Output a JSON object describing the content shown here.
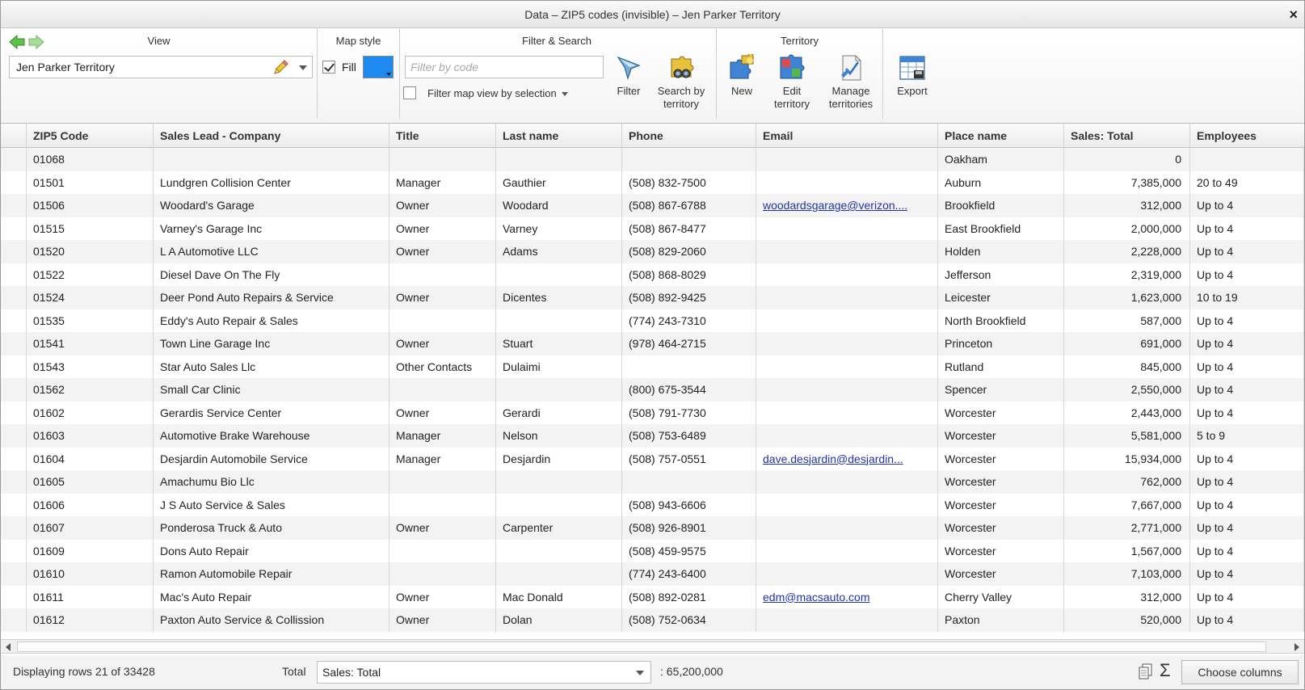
{
  "window": {
    "title": "Data – ZIP5 codes (invisible) – Jen Parker Territory",
    "close_glyph": "×"
  },
  "ribbon": {
    "view": {
      "title": "View",
      "selected": "Jen Parker Territory"
    },
    "map_style": {
      "title": "Map style",
      "fill_label": "Fill",
      "fill_checked": true,
      "fill_color": "#1e8af0"
    },
    "filter_search": {
      "title": "Filter & Search",
      "placeholder": "Filter by code",
      "value": "",
      "selection_label": "Filter map view by selection",
      "filter_label": "Filter",
      "search_label_1": "Search by",
      "search_label_2": "territory"
    },
    "territory": {
      "title": "Territory",
      "new_label": "New",
      "edit_label_1": "Edit",
      "edit_label_2": "territory",
      "manage_label_1": "Manage",
      "manage_label_2": "territories"
    },
    "export_label": "Export"
  },
  "grid": {
    "columns": {
      "zip": "ZIP5 Code",
      "company": "Sales Lead - Company",
      "title": "Title",
      "last": "Last name",
      "phone": "Phone",
      "email": "Email",
      "place": "Place name",
      "sales": "Sales: Total",
      "employees": "Employees"
    },
    "rows": [
      {
        "zip": "01068",
        "company": "",
        "title": "",
        "last": "",
        "phone": "",
        "email": "",
        "place": "Oakham",
        "sales": "0",
        "employees": ""
      },
      {
        "zip": "01501",
        "company": "Lundgren Collision Center",
        "title": "Manager",
        "last": "Gauthier",
        "phone": "(508) 832-7500",
        "email": "",
        "place": "Auburn",
        "sales": "7,385,000",
        "employees": "20 to 49"
      },
      {
        "zip": "01506",
        "company": "Woodard's Garage",
        "title": "Owner",
        "last": "Woodard",
        "phone": "(508) 867-6788",
        "email": "woodardsgarage@verizon....",
        "place": "Brookfield",
        "sales": "312,000",
        "employees": "Up to 4"
      },
      {
        "zip": "01515",
        "company": "Varney's Garage Inc",
        "title": "Owner",
        "last": "Varney",
        "phone": "(508) 867-8477",
        "email": "",
        "place": "East Brookfield",
        "sales": "2,000,000",
        "employees": "Up to 4"
      },
      {
        "zip": "01520",
        "company": "L A Automotive LLC",
        "title": "Owner",
        "last": "Adams",
        "phone": "(508) 829-2060",
        "email": "",
        "place": "Holden",
        "sales": "2,228,000",
        "employees": "Up to 4"
      },
      {
        "zip": "01522",
        "company": "Diesel Dave On The Fly",
        "title": "",
        "last": "",
        "phone": "(508) 868-8029",
        "email": "",
        "place": "Jefferson",
        "sales": "2,319,000",
        "employees": "Up to 4"
      },
      {
        "zip": "01524",
        "company": "Deer Pond Auto Repairs & Service",
        "title": "Owner",
        "last": "Dicentes",
        "phone": "(508) 892-9425",
        "email": "",
        "place": "Leicester",
        "sales": "1,623,000",
        "employees": "10 to 19"
      },
      {
        "zip": "01535",
        "company": "Eddy's Auto Repair & Sales",
        "title": "",
        "last": "",
        "phone": "(774) 243-7310",
        "email": "",
        "place": "North Brookfield",
        "sales": "587,000",
        "employees": "Up to 4"
      },
      {
        "zip": "01541",
        "company": "Town Line Garage Inc",
        "title": "Owner",
        "last": "Stuart",
        "phone": "(978) 464-2715",
        "email": "",
        "place": "Princeton",
        "sales": "691,000",
        "employees": "Up to 4"
      },
      {
        "zip": "01543",
        "company": "Star Auto Sales Llc",
        "title": "Other Contacts",
        "last": "Dulaimi",
        "phone": "",
        "email": "",
        "place": "Rutland",
        "sales": "845,000",
        "employees": "Up to 4"
      },
      {
        "zip": "01562",
        "company": "Small Car Clinic",
        "title": "",
        "last": "",
        "phone": "(800) 675-3544",
        "email": "",
        "place": "Spencer",
        "sales": "2,550,000",
        "employees": "Up to 4"
      },
      {
        "zip": "01602",
        "company": "Gerardis Service Center",
        "title": "Owner",
        "last": "Gerardi",
        "phone": "(508) 791-7730",
        "email": "",
        "place": "Worcester",
        "sales": "2,443,000",
        "employees": "Up to 4"
      },
      {
        "zip": "01603",
        "company": "Automotive Brake Warehouse",
        "title": "Manager",
        "last": "Nelson",
        "phone": "(508) 753-6489",
        "email": "",
        "place": "Worcester",
        "sales": "5,581,000",
        "employees": "5 to 9"
      },
      {
        "zip": "01604",
        "company": "Desjardin Automobile Service",
        "title": "Manager",
        "last": "Desjardin",
        "phone": "(508) 757-0551",
        "email": "dave.desjardin@desjardin...",
        "place": "Worcester",
        "sales": "15,934,000",
        "employees": "Up to 4"
      },
      {
        "zip": "01605",
        "company": "Amachumu Bio Llc",
        "title": "",
        "last": "",
        "phone": "",
        "email": "",
        "place": "Worcester",
        "sales": "762,000",
        "employees": "Up to 4"
      },
      {
        "zip": "01606",
        "company": "J S Auto Service & Sales",
        "title": "",
        "last": "",
        "phone": "(508) 943-6606",
        "email": "",
        "place": "Worcester",
        "sales": "7,667,000",
        "employees": "Up to 4"
      },
      {
        "zip": "01607",
        "company": "Ponderosa Truck & Auto",
        "title": "Owner",
        "last": "Carpenter",
        "phone": "(508) 926-8901",
        "email": "",
        "place": "Worcester",
        "sales": "2,771,000",
        "employees": "Up to 4"
      },
      {
        "zip": "01609",
        "company": "Dons Auto Repair",
        "title": "",
        "last": "",
        "phone": "(508) 459-9575",
        "email": "",
        "place": "Worcester",
        "sales": "1,567,000",
        "employees": "Up to 4"
      },
      {
        "zip": "01610",
        "company": "Ramon Automobile Repair",
        "title": "",
        "last": "",
        "phone": "(774) 243-6400",
        "email": "",
        "place": "Worcester",
        "sales": "7,103,000",
        "employees": "Up to 4"
      },
      {
        "zip": "01611",
        "company": "Mac's Auto Repair",
        "title": "Owner",
        "last": "Mac Donald",
        "phone": "(508) 892-0281",
        "email": "edm@macsauto.com",
        "place": "Cherry Valley",
        "sales": "312,000",
        "employees": "Up to 4"
      },
      {
        "zip": "01612",
        "company": "Paxton Auto Service & Collission",
        "title": "Owner",
        "last": "Dolan",
        "phone": "(508) 752-0634",
        "email": "",
        "place": "Paxton",
        "sales": "520,000",
        "employees": "Up to 4"
      }
    ]
  },
  "status": {
    "displaying": "Displaying rows 21 of 33428",
    "total_label": "Total",
    "total_field": "Sales: Total",
    "total_value": ": 65,200,000",
    "sigma": "Σ",
    "choose_columns": "Choose columns"
  }
}
